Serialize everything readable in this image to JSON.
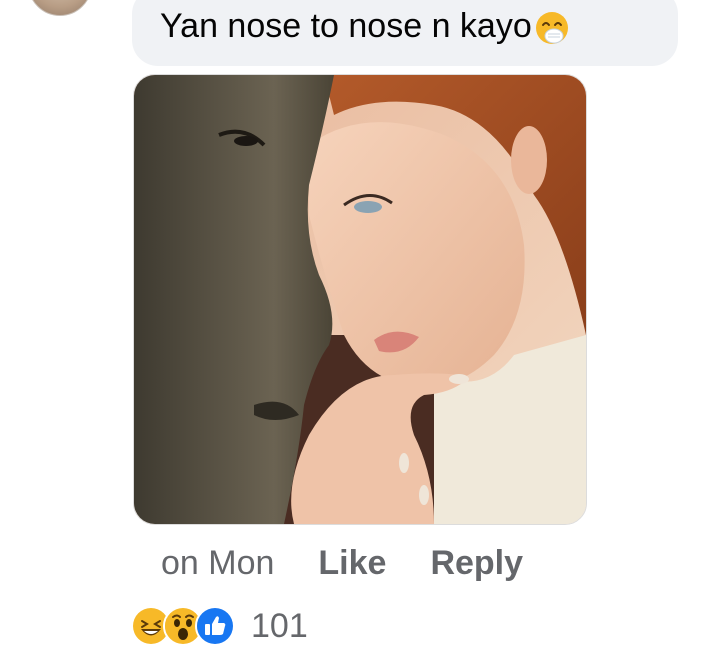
{
  "comment": {
    "text": "Yan nose to nose n kayo",
    "emoji": "face-with-hand-over-mouth-icon"
  },
  "meta": {
    "time": "on Mon",
    "like_label": "Like",
    "reply_label": "Reply"
  },
  "reactions": {
    "icons": [
      "laughing-face-icon",
      "surprised-face-icon",
      "like-thumb-icon"
    ],
    "count": "101"
  },
  "colors": {
    "bubble": "#f0f2f5",
    "meta_text": "#65676b",
    "like_blue": "#1877f2",
    "reaction_yellow": "#f7b928"
  }
}
